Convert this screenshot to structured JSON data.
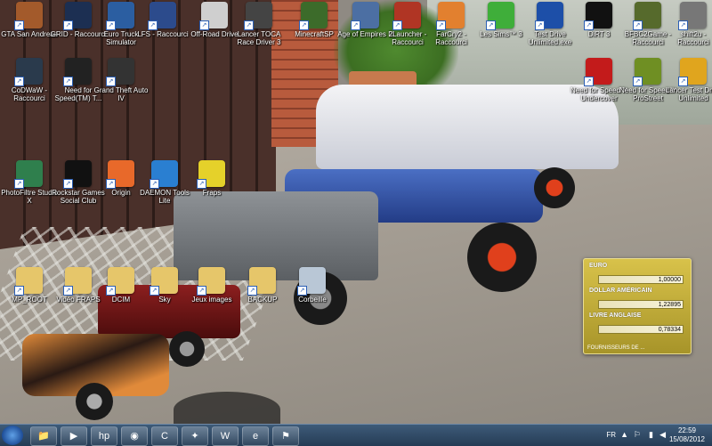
{
  "desktop_icons": [
    {
      "label": "GTA San Andreas",
      "color": "#a35a2b"
    },
    {
      "label": "GRID - Raccourci",
      "color": "#1c2f52"
    },
    {
      "label": "Euro Truck Simulator",
      "color": "#2b5ea1"
    },
    {
      "label": "LFS - Raccourci",
      "color": "#2c4b8c"
    },
    {
      "label": "Off-Road Drive",
      "color": "#cfcfcf"
    },
    {
      "label": "Lancer TOCA Race Driver 3",
      "color": "#444444"
    },
    {
      "label": "MinecraftSP",
      "color": "#3c6b2a"
    },
    {
      "label": "Age of Empires III",
      "color": "#4c6fa3"
    },
    {
      "label": "2Launcher - Raccourci",
      "color": "#b03524"
    },
    {
      "label": "FarCry2 - Raccourci",
      "color": "#e2802f"
    },
    {
      "label": "Les Sims™ 3",
      "color": "#3fae3a"
    },
    {
      "label": "Test Drive Unlimited.exe",
      "color": "#1d4fa8"
    },
    {
      "label": "DiRT 3",
      "color": "#111111"
    },
    {
      "label": "BFBC2Game - Raccourci",
      "color": "#566a2c"
    },
    {
      "label": "shift2u - Raccourci",
      "color": "#777777"
    },
    {
      "label": "CoDWaW - Raccourci",
      "color": "#2a3a4c"
    },
    {
      "label": "Need for Speed(TM) T...",
      "color": "#222222"
    },
    {
      "label": "Grand Theft Auto IV",
      "color": "#333333"
    },
    {
      "label": "Need for Speed™ Undercover",
      "color": "#c31b1b"
    },
    {
      "label": "Need for Speed™ ProStreet",
      "color": "#6f8f23"
    },
    {
      "label": "Lancer Test Drive Unlimited",
      "color": "#e0a51e"
    },
    {
      "label": "PhotoFiltre Studio X",
      "color": "#2f7f4d"
    },
    {
      "label": "Rockstar Games Social Club",
      "color": "#111111"
    },
    {
      "label": "Origin",
      "color": "#e8692a"
    },
    {
      "label": "DAEMON Tools Lite",
      "color": "#2a7fd1"
    },
    {
      "label": "Fraps",
      "color": "#e5d12a"
    },
    {
      "label": "MP_ROOT",
      "color": "#e6c66a"
    },
    {
      "label": "Vidéo FRAPS",
      "color": "#e6c66a"
    },
    {
      "label": "DCIM",
      "color": "#e6c66a"
    },
    {
      "label": "Sky",
      "color": "#e6c66a"
    },
    {
      "label": "Jeux images",
      "color": "#e6c66a"
    },
    {
      "label": "BACKUP",
      "color": "#e6c66a"
    },
    {
      "label": "Corbeille",
      "color": "#b9c7d6"
    }
  ],
  "gadget": {
    "rows": [
      {
        "currency": "EURO",
        "value": "1,00000"
      },
      {
        "currency": "DOLLAR AMÉRICAIN",
        "value": "1,22895"
      },
      {
        "currency": "LIVRE ANGLAISE",
        "value": "0,78334"
      }
    ],
    "footer": "FOURNISSEURS DE ..."
  },
  "taskbar": {
    "pinned": [
      {
        "name": "windows-explorer",
        "glyph": "📁"
      },
      {
        "name": "media-player",
        "glyph": "▶"
      },
      {
        "name": "hp",
        "glyph": "hp"
      },
      {
        "name": "chrome",
        "glyph": "◉"
      },
      {
        "name": "ccleaner",
        "glyph": "C"
      },
      {
        "name": "game-app",
        "glyph": "✦"
      },
      {
        "name": "winrar",
        "glyph": "W"
      },
      {
        "name": "eset",
        "glyph": "e"
      },
      {
        "name": "network-app",
        "glyph": "⚑"
      }
    ],
    "language": "FR",
    "time": "22:59",
    "date": "15/08/2012"
  }
}
